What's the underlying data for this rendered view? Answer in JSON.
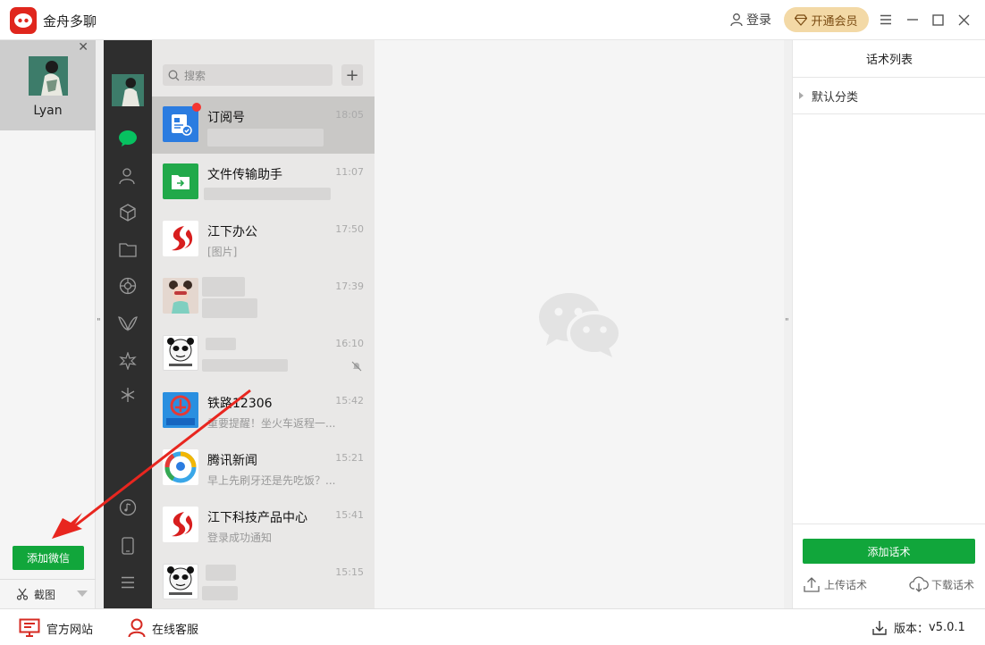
{
  "app": {
    "title": "金舟多聊",
    "login_label": "登录",
    "vip_label": "开通会员"
  },
  "accounts": {
    "items": [
      {
        "name": "Lyan"
      }
    ],
    "add_wechat_label": "添加微信",
    "screenshot_label": "截图"
  },
  "wechat": {
    "search_placeholder": "搜索",
    "chats": [
      {
        "name": "订阅号",
        "time": "18:05",
        "preview": ""
      },
      {
        "name": "文件传输助手",
        "time": "11:07",
        "preview": ""
      },
      {
        "name": "江下办公",
        "time": "17:50",
        "preview": "[图片]"
      },
      {
        "name": "",
        "time": "17:39",
        "preview": ""
      },
      {
        "name": "",
        "time": "16:10",
        "preview": ""
      },
      {
        "name": "铁路12306",
        "time": "15:42",
        "preview": "重要提醒！坐火车返程一..."
      },
      {
        "name": "腾讯新闻",
        "time": "15:21",
        "preview": "早上先刷牙还是先吃饭？..."
      },
      {
        "name": "江下科技产品中心",
        "time": "15:41",
        "preview": "登录成功通知"
      },
      {
        "name": "",
        "time": "15:15",
        "preview": ""
      }
    ]
  },
  "scripts_panel": {
    "title": "话术列表",
    "category": "默认分类",
    "add_label": "添加话术",
    "upload_label": "上传话术",
    "download_label": "下载话术"
  },
  "statusbar": {
    "website_label": "官方网站",
    "service_label": "在线客服",
    "version_label": "版本：",
    "version": "v5.0.1"
  },
  "colors": {
    "brand_red": "#e0261d",
    "accent_green": "#11a63b",
    "wechat_sidebar": "#2e2e2e",
    "annotation_red": "#e8261f"
  }
}
